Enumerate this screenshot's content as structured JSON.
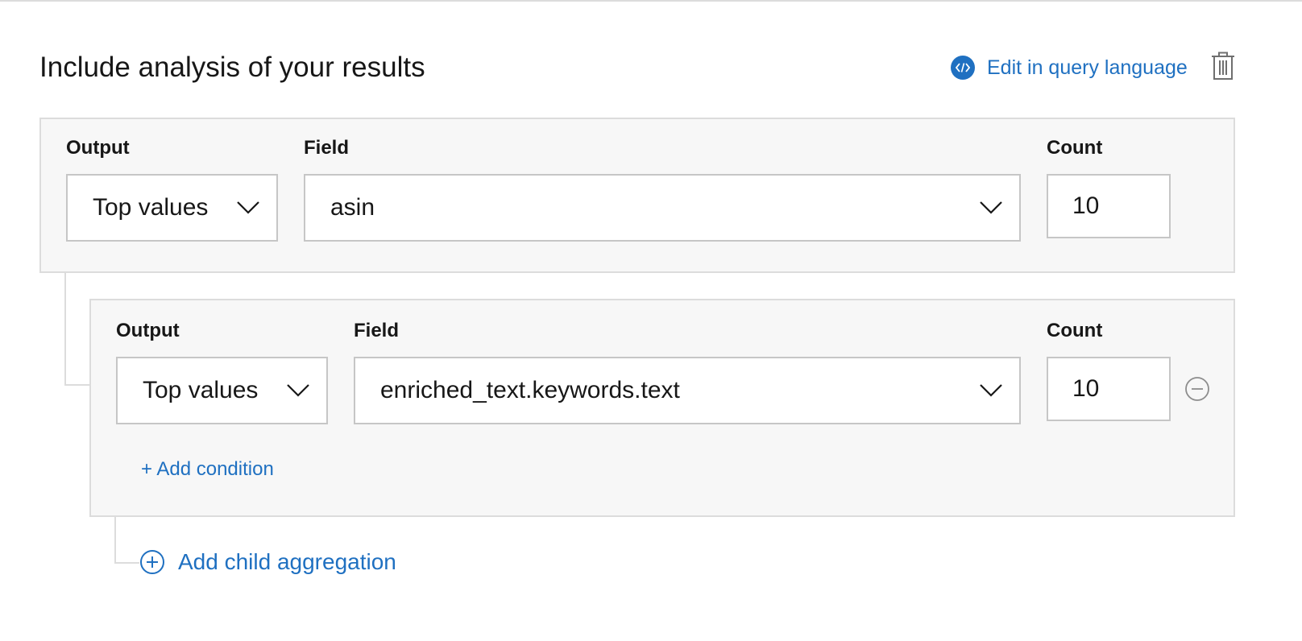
{
  "header": {
    "title": "Include analysis of your results",
    "edit_link_label": "Edit in query language",
    "edit_link_icon": "code-icon",
    "delete_icon": "trash-icon"
  },
  "aggregation": {
    "output_label": "Output",
    "field_label": "Field",
    "count_label": "Count",
    "output_value": "Top values",
    "field_value": "asin",
    "count_value": "10"
  },
  "child_aggregation": {
    "output_label": "Output",
    "field_label": "Field",
    "count_label": "Count",
    "output_value": "Top values",
    "field_value": "enriched_text.keywords.text",
    "count_value": "10",
    "remove_icon": "minus-circle-icon",
    "add_condition_label": "+ Add condition"
  },
  "add_child_label": "Add child aggregation",
  "add_child_icon": "plus-circle-icon",
  "colors": {
    "link_blue": "#1f70c1",
    "panel_bg": "#f7f7f7",
    "border": "#dcdcdc"
  }
}
